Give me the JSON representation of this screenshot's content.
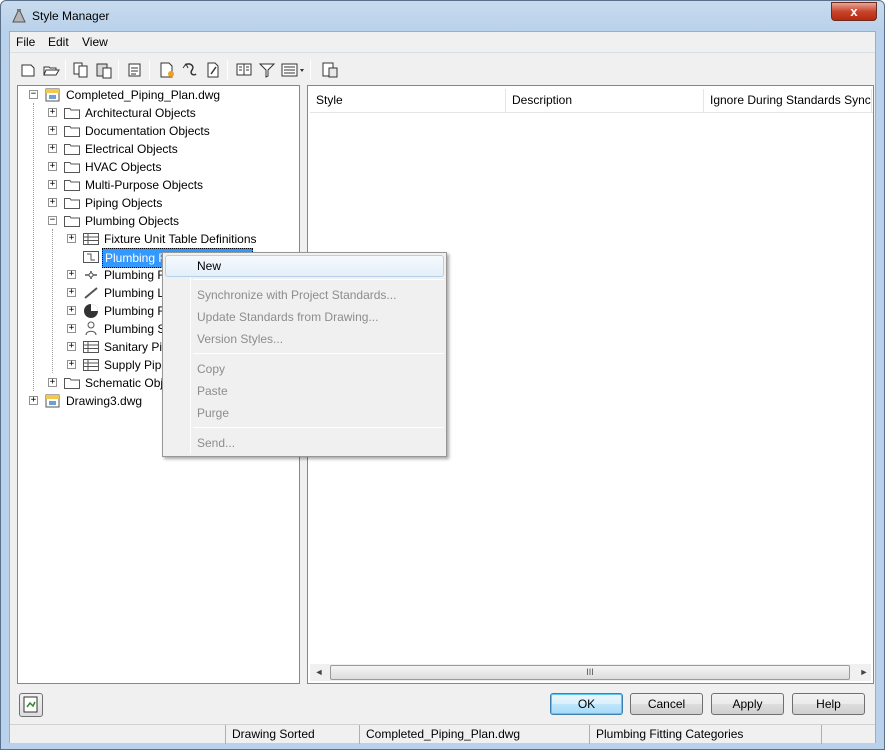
{
  "window": {
    "title": "Style Manager",
    "close_glyph": "x"
  },
  "menu": [
    "File",
    "Edit",
    "View"
  ],
  "toolbar": {
    "buttons": [
      "new-drawing-icon",
      "open-drawing-icon",
      "copy-icon",
      "paste-icon",
      "purge-icon",
      "new-style-icon",
      "set-from-icon",
      "edit-style-icon",
      "toggle-view-icon",
      "filter-icon",
      "view-mode-icon",
      "inline-edit-icon"
    ]
  },
  "tree": {
    "root1": "Completed_Piping_Plan.dwg",
    "categories": [
      "Architectural Objects",
      "Documentation Objects",
      "Electrical Objects",
      "HVAC Objects",
      "Multi-Purpose Objects",
      "Piping Objects",
      "Plumbing Objects"
    ],
    "plumbing_children": [
      "Fixture Unit Table Definitions",
      "Plumbing Fitting Categories",
      "Plumbing Fittings",
      "Plumbing Line Styles",
      "Plumbing Riser Styles",
      "Plumbing Systems",
      "Sanitary Pipe Sizing",
      "Supply Pipe Sizing"
    ],
    "plumbing_children_visible": [
      "Fixture Unit Table Definitions",
      "Plumbing Fit",
      "Plumbing Fit",
      "Plumbing Lin",
      "Plumbing Ris",
      "Plumbing Sys",
      "Sanitary Pipe",
      "Supply Pipe S"
    ],
    "after_plumbing": "Schematic Objec",
    "root2": "Drawing3.dwg"
  },
  "list": {
    "columns": [
      "Style",
      "Description",
      "Ignore During Standards Synchron"
    ],
    "scroll_thumb": "III",
    "scroll_left": "◄",
    "scroll_right": "►"
  },
  "context_menu": {
    "items": [
      {
        "label": "New",
        "enabled": true
      },
      {
        "label": "Synchronize with Project Standards...",
        "enabled": false
      },
      {
        "label": "Update Standards from Drawing...",
        "enabled": false
      },
      {
        "label": "Version Styles...",
        "enabled": false
      },
      {
        "label": "Copy",
        "enabled": false
      },
      {
        "label": "Paste",
        "enabled": false
      },
      {
        "label": "Purge",
        "enabled": false
      },
      {
        "label": "Send...",
        "enabled": false
      }
    ]
  },
  "buttons": {
    "ok": "OK",
    "cancel": "Cancel",
    "apply": "Apply",
    "help": "Help"
  },
  "status": {
    "sort": "Drawing Sorted",
    "file": "Completed_Piping_Plan.dwg",
    "category": "Plumbing Fitting Categories"
  },
  "colors": {
    "selection": "#3399ff",
    "title_gradient": "#b9d1ea",
    "close_button": "#c7452d"
  }
}
